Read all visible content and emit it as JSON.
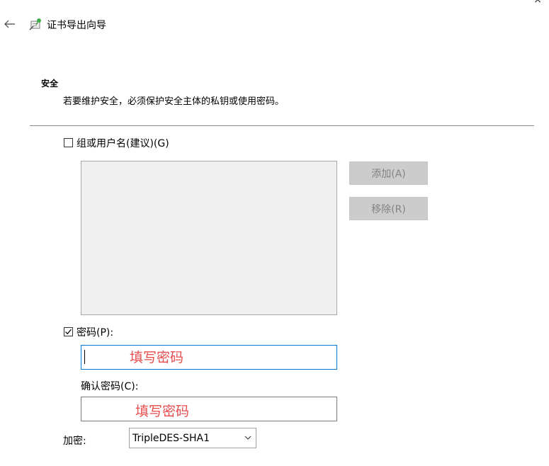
{
  "window": {
    "close_glyph": "×"
  },
  "header": {
    "back_icon": "back-arrow-icon",
    "wizard_icon": "certificate-wizard-icon",
    "title": "证书导出向导"
  },
  "section": {
    "title": "安全",
    "description": "若要维护安全，必须保护安全主体的私钥或使用密码。"
  },
  "group": {
    "checkbox_label": "组或用户名(建议)(G)",
    "checked": false,
    "add_button": "添加(A)",
    "remove_button": "移除(R)"
  },
  "password": {
    "checkbox_label": "密码(P):",
    "checked": true,
    "value": "",
    "annotation": "填写密码"
  },
  "confirm": {
    "label": "确认密码(C):",
    "value": "",
    "annotation": "填写密码"
  },
  "encryption": {
    "label": "加密:",
    "selected": "TripleDES-SHA1"
  },
  "colors": {
    "focus_border": "#0078d7",
    "annotation": "#e84c4c",
    "disabled_button_bg": "#cccccc",
    "disabled_text": "#838383"
  }
}
